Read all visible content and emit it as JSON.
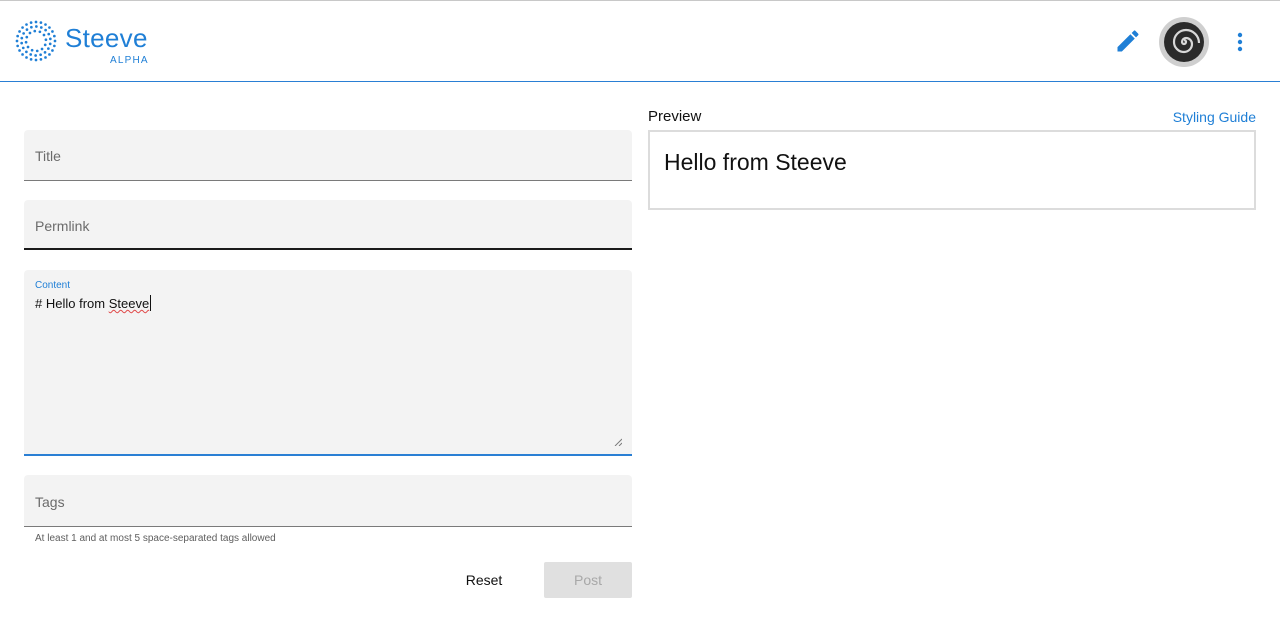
{
  "brand": {
    "name": "Steeve",
    "sub": "ALPHA"
  },
  "header": {
    "edit_icon": "pencil-icon",
    "avatar_icon": "swirl-avatar",
    "more_icon": "more-vert-icon"
  },
  "form": {
    "title_label": "Title",
    "permlink_label": "Permlink",
    "content_label": "Content",
    "content_prefix": "# Hello from ",
    "content_misspelled": "Steeve",
    "tags_label": "Tags",
    "tags_helper": "At least 1 and at most 5 space-separated tags allowed",
    "reset_label": "Reset",
    "post_label": "Post"
  },
  "preview": {
    "label": "Preview",
    "styling_link": "Styling Guide",
    "heading": "Hello from Steeve"
  },
  "colors": {
    "accent": "#1f7fd6",
    "field_bg": "#f3f3f3",
    "disabled_bg": "#e0e0e0"
  }
}
